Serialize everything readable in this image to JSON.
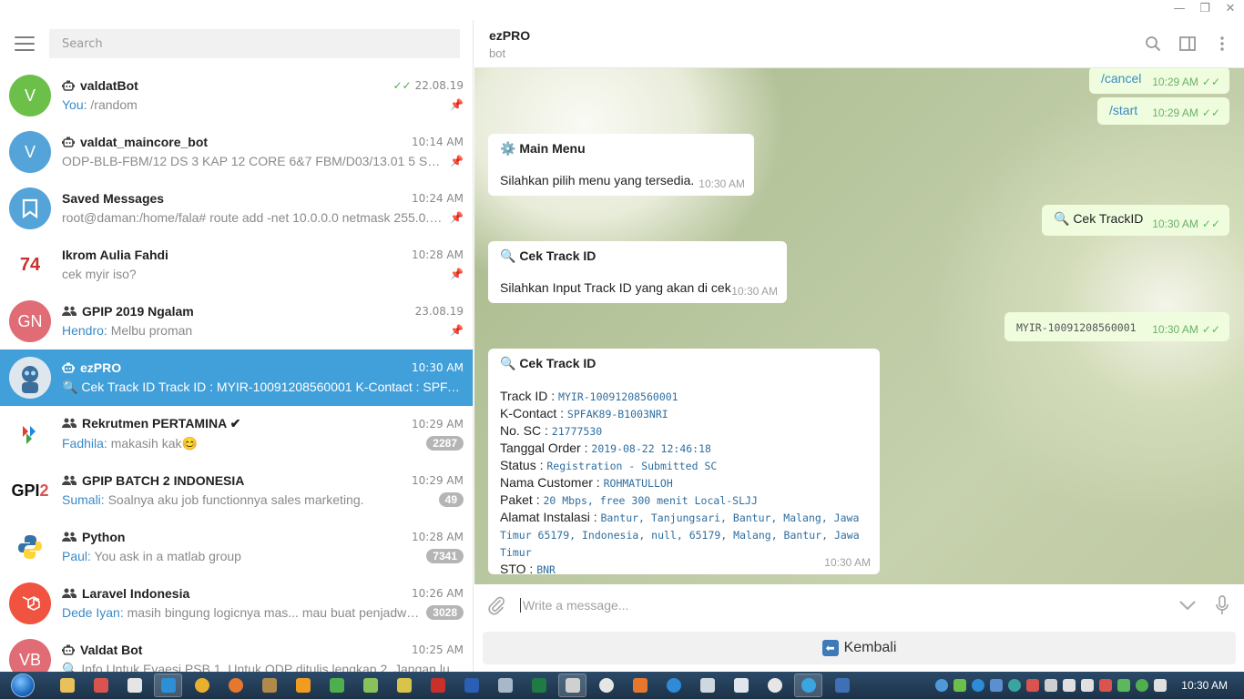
{
  "window": {
    "minimize_glyph": "—",
    "maximize_glyph": "❐",
    "close_glyph": "✕"
  },
  "search": {
    "placeholder": "Search"
  },
  "chats": [
    {
      "name": "valdatBot",
      "kind": "bot",
      "time": "22.08.19",
      "read_checks": "✓✓",
      "sender": "You:",
      "preview": " /random",
      "pinned": true,
      "avatar_text": "V",
      "avatar_color": "#6cc04a"
    },
    {
      "name": "valdat_maincore_bot",
      "kind": "bot",
      "time": "10:14 AM",
      "sender": "",
      "preview": "ODP-BLB-FBM/12 DS 3 KAP 12 CORE 6&7 FBM/D03/13.01 5 SPL-C KAP...",
      "pinned": true,
      "avatar_text": "V",
      "avatar_color": "#55a4d9"
    },
    {
      "name": "Saved Messages",
      "kind": "saved",
      "time": "10:24 AM",
      "sender": "",
      "preview": "root@daman:/home/fala# route add -net 10.0.0.0 netmask 255.0.0.0 ...",
      "pinned": true,
      "avatar_text": "",
      "avatar_color": "#55a4d9"
    },
    {
      "name": "Ikrom Aulia Fahdi",
      "kind": "user",
      "time": "10:28 AM",
      "sender": "",
      "preview": "cek myir iso?",
      "pinned": true,
      "avatar_text": "",
      "avatar_color": "#ffffff"
    },
    {
      "name": "GPIP 2019 Ngalam",
      "kind": "group",
      "time": "23.08.19",
      "sender": "Hendro:",
      "preview": " Melbu proman",
      "pinned": true,
      "avatar_text": "GN",
      "avatar_color": "#e06c75"
    },
    {
      "name": "ezPRO",
      "kind": "bot",
      "time": "10:30 AM",
      "sender": "",
      "preview": "🔍 Cek Track ID  Track ID : MYIR-10091208560001 K-Contact : SPFAK89-B...",
      "pinned": false,
      "active": true,
      "avatar_text": "",
      "avatar_color": "#c9d6e3"
    },
    {
      "name": "Rekrutmen PERTAMINA ✔",
      "kind": "group",
      "time": "10:29 AM",
      "sender": "Fadhila:",
      "preview": " makasih kak😊",
      "badge": "2287",
      "avatar_text": "",
      "avatar_color": "#ffffff"
    },
    {
      "name": "GPIP BATCH 2 INDONESIA",
      "kind": "group",
      "time": "10:29 AM",
      "sender": "Sumali:",
      "preview": " Soalnya aku job functionnya sales marketing.",
      "badge": "49",
      "avatar_text": "GPI2",
      "avatar_color": "#ffffff"
    },
    {
      "name": "Python",
      "kind": "group",
      "time": "10:28 AM",
      "sender": "Paul:",
      "preview": " You ask in a matlab group",
      "badge": "7341",
      "avatar_text": "",
      "avatar_color": "#ffffff"
    },
    {
      "name": "Laravel Indonesia",
      "kind": "group",
      "time": "10:26 AM",
      "sender": "Dede Iyan:",
      "preview": " masih bingung logicnya mas... mau buat penjadwalan ...",
      "badge": "3028",
      "avatar_text": "",
      "avatar_color": "#f05340"
    },
    {
      "name": "Valdat Bot",
      "kind": "bot",
      "time": "10:25 AM",
      "sender": "",
      "preview": "🔍 Info Untuk Evaesi PSB  1. Untuk ODP ditulis lengkap  2. Jangan lupa u...",
      "avatar_text": "VB",
      "avatar_color": "#e06c75"
    }
  ],
  "peer": {
    "name": "ezPRO",
    "status": "bot"
  },
  "messages": {
    "cancel": {
      "text": "/cancel",
      "time": "10:29 AM"
    },
    "start": {
      "text": "/start",
      "time": "10:29 AM"
    },
    "main_menu": {
      "title": "⚙️ Main Menu",
      "body": "Silahkan pilih menu yang tersedia.",
      "time": "10:30 AM"
    },
    "cek_trackid": {
      "text": "🔍 Cek TrackID",
      "time": "10:30 AM"
    },
    "cek_track_prompt": {
      "title": "🔍 Cek Track ID",
      "body": "Silahkan Input Track ID yang akan di cek",
      "time": "10:30 AM"
    },
    "myir": {
      "text": "MYIR-10091208560001",
      "time": "10:30 AM"
    },
    "result": {
      "title": "🔍 Cek Track ID",
      "time": "10:30 AM",
      "rows": [
        {
          "label": "Track ID : ",
          "value": "MYIR-10091208560001"
        },
        {
          "label": "K-Contact : ",
          "value": "SPFAK89-B1003NRI"
        },
        {
          "label": "No. SC : ",
          "value": "21777530"
        },
        {
          "label": "Tanggal Order : ",
          "value": "2019-08-22 12:46:18"
        },
        {
          "label": "Status : ",
          "value": "Registration - Submitted SC"
        },
        {
          "label": "Nama Customer : ",
          "value": "ROHMATULLOH"
        },
        {
          "label": "Paket : ",
          "value": "20 Mbps, free 300 menit Local-SLJJ"
        },
        {
          "label": "Alamat Instalasi : ",
          "value": "Bantur, Tanjungsari, Bantur, Malang, Jawa Timur 65179, Indonesia, null, 65179, Malang, Bantur, Jawa Timur"
        },
        {
          "label": "STO : ",
          "value": "BNR"
        }
      ]
    }
  },
  "composer": {
    "placeholder": "Write a message..."
  },
  "keyboard": {
    "button_label": "Kembali",
    "button_icon": "⬅"
  },
  "taskbar": {
    "clock": "10:30 AM"
  }
}
